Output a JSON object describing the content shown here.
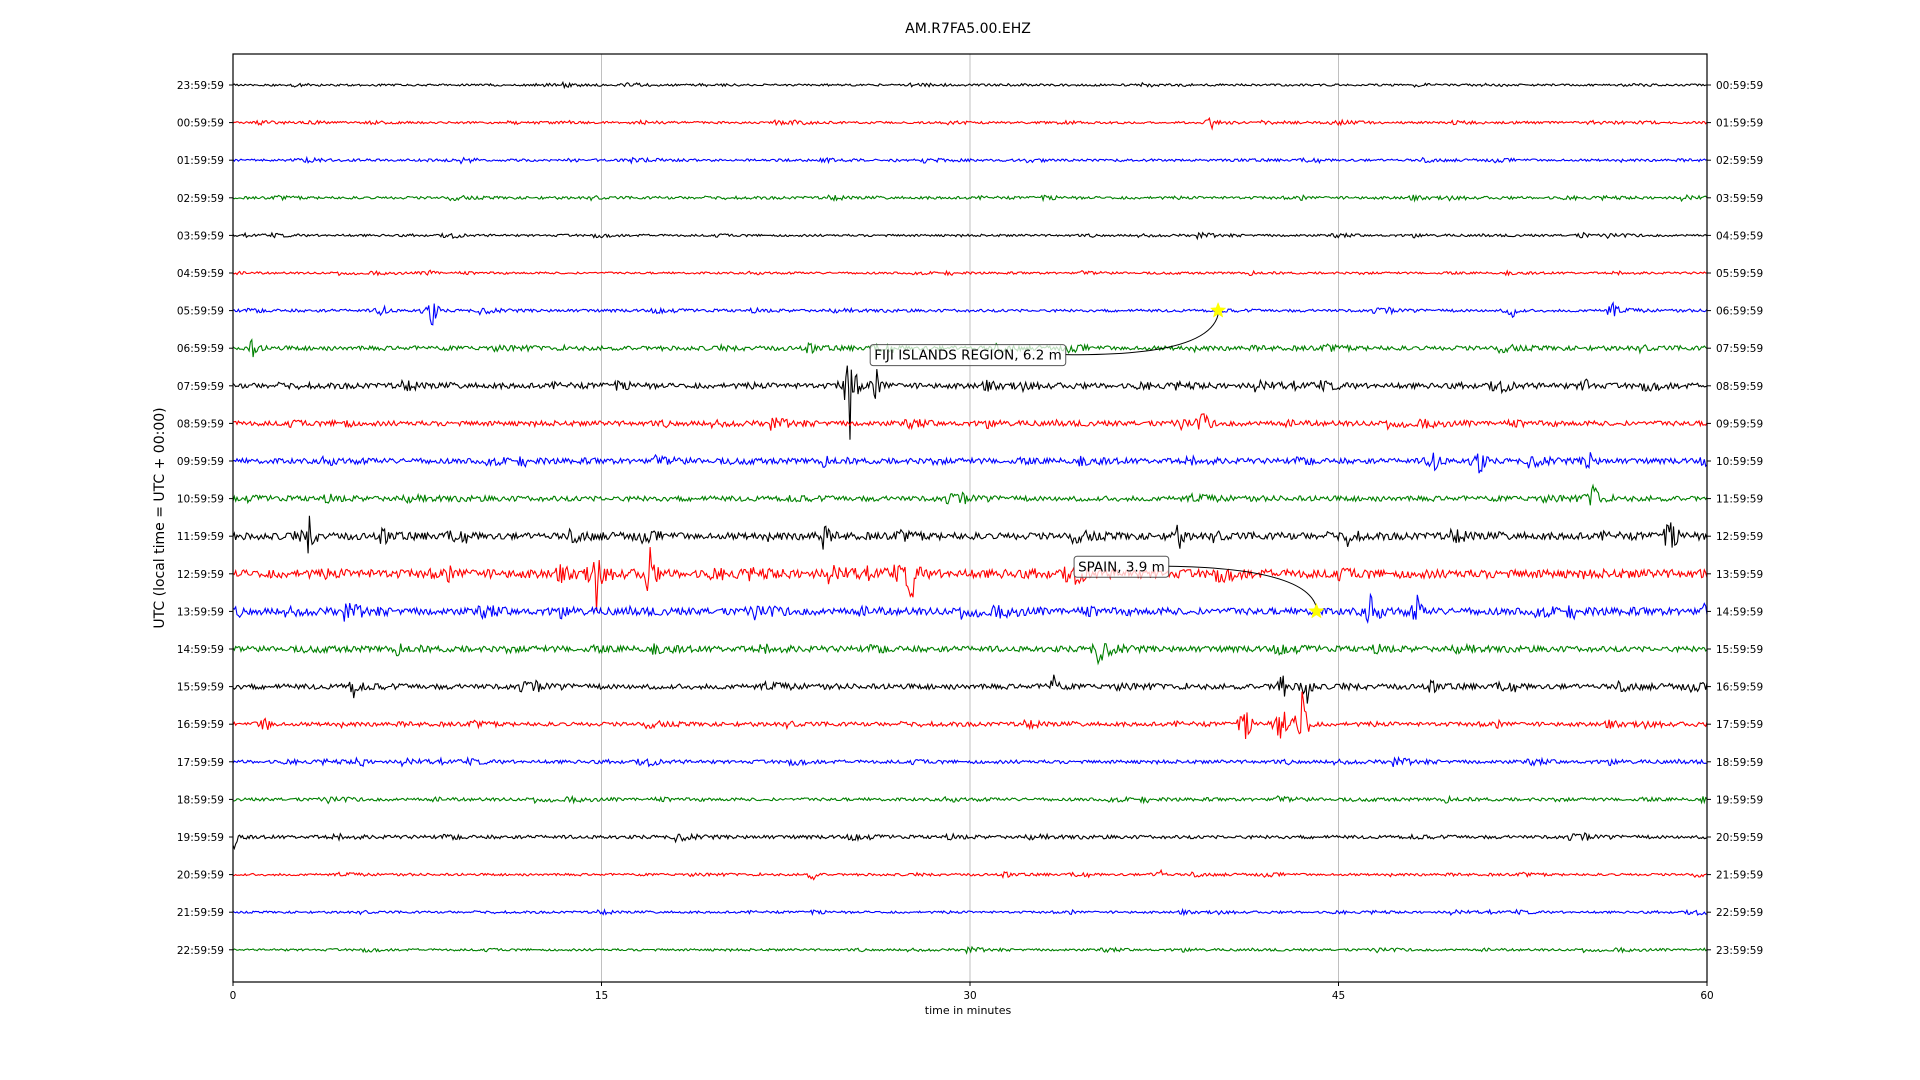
{
  "chart_data": {
    "type": "line",
    "title": "AM.R7FA5.00.EHZ",
    "xlabel": "time in minutes",
    "ylabel": "UTC (local time = UTC + 00:00)",
    "xlim": [
      0,
      60
    ],
    "xticks": [
      "0",
      "15",
      "30",
      "45",
      "60"
    ],
    "xtick_values": [
      0,
      15,
      30,
      45,
      60
    ],
    "grid": "vertical",
    "left_labels": [
      "23:59:59",
      "00:59:59",
      "01:59:59",
      "02:59:59",
      "03:59:59",
      "04:59:59",
      "05:59:59",
      "06:59:59",
      "07:59:59",
      "08:59:59",
      "09:59:59",
      "10:59:59",
      "11:59:59",
      "12:59:59",
      "13:59:59",
      "14:59:59",
      "15:59:59",
      "16:59:59",
      "17:59:59",
      "18:59:59",
      "19:59:59",
      "20:59:59",
      "21:59:59",
      "22:59:59"
    ],
    "right_labels": [
      "00:59:59",
      "01:59:59",
      "02:59:59",
      "03:59:59",
      "04:59:59",
      "05:59:59",
      "06:59:59",
      "07:59:59",
      "08:59:59",
      "09:59:59",
      "10:59:59",
      "11:59:59",
      "12:59:59",
      "13:59:59",
      "14:59:59",
      "15:59:59",
      "16:59:59",
      "17:59:59",
      "18:59:59",
      "19:59:59",
      "20:59:59",
      "21:59:59",
      "22:59:59",
      "23:59:59"
    ],
    "trace_colors": [
      "#000000",
      "#ff0000",
      "#0000ff",
      "#008000"
    ],
    "noise_levels": [
      1.0,
      1.1,
      1.2,
      1.3,
      1.1,
      1.0,
      1.4,
      2.2,
      2.6,
      2.4,
      2.6,
      2.6,
      3.4,
      4.2,
      3.4,
      2.8,
      2.6,
      2.0,
      1.7,
      1.5,
      1.7,
      1.2,
      1.1,
      1.1
    ],
    "spikes": [
      {
        "row": 1,
        "minute": 39.8,
        "amp": 7
      },
      {
        "row": 4,
        "minute": 55,
        "amp": 3
      },
      {
        "row": 5,
        "minute": 8,
        "amp": 5
      },
      {
        "row": 6,
        "minute": 8.1,
        "amp": 22
      },
      {
        "row": 6,
        "minute": 6.1,
        "amp": 9
      },
      {
        "row": 6,
        "minute": 52.1,
        "amp": 8
      },
      {
        "row": 6,
        "minute": 56.1,
        "amp": 10
      },
      {
        "row": 7,
        "minute": 0.8,
        "amp": 10
      },
      {
        "row": 8,
        "minute": 25.1,
        "amp": 60
      },
      {
        "row": 8,
        "minute": 26.2,
        "amp": 12
      },
      {
        "row": 8,
        "minute": 55.1,
        "amp": 9
      },
      {
        "row": 9,
        "minute": 4.5,
        "amp": 12
      },
      {
        "row": 9,
        "minute": 39.5,
        "amp": 12
      },
      {
        "row": 10,
        "minute": 48.9,
        "amp": 18
      },
      {
        "row": 10,
        "minute": 50.7,
        "amp": 20
      },
      {
        "row": 10,
        "minute": 55.2,
        "amp": 12
      },
      {
        "row": 11,
        "minute": 55.4,
        "amp": 22
      },
      {
        "row": 12,
        "minute": 3.1,
        "amp": 22
      },
      {
        "row": 12,
        "minute": 24,
        "amp": 14
      },
      {
        "row": 12,
        "minute": 38.5,
        "amp": 14
      },
      {
        "row": 12,
        "minute": 45.5,
        "amp": 14
      },
      {
        "row": 12,
        "minute": 58.5,
        "amp": 16
      },
      {
        "row": 13,
        "minute": 14.8,
        "amp": 30
      },
      {
        "row": 13,
        "minute": 17,
        "amp": 28
      },
      {
        "row": 13,
        "minute": 27.6,
        "amp": 28
      },
      {
        "row": 14,
        "minute": 46.3,
        "amp": 16
      },
      {
        "row": 14,
        "minute": 48.2,
        "amp": 14
      },
      {
        "row": 15,
        "minute": 35.2,
        "amp": 12
      },
      {
        "row": 16,
        "minute": 4.9,
        "amp": 10
      },
      {
        "row": 16,
        "minute": 33.4,
        "amp": 12
      },
      {
        "row": 16,
        "minute": 42.7,
        "amp": 22
      },
      {
        "row": 16,
        "minute": 43.7,
        "amp": 26
      },
      {
        "row": 17,
        "minute": 1.3,
        "amp": 14
      },
      {
        "row": 17,
        "minute": 41.2,
        "amp": 18
      },
      {
        "row": 17,
        "minute": 42.7,
        "amp": 34
      },
      {
        "row": 17,
        "minute": 43.5,
        "amp": 60
      },
      {
        "row": 18,
        "minute": 5.2,
        "amp": 6
      },
      {
        "row": 20,
        "minute": 0.05,
        "amp": 12
      },
      {
        "row": 21,
        "minute": 23.6,
        "amp": 6
      },
      {
        "row": 21,
        "minute": 37.7,
        "amp": 6
      }
    ],
    "annotations": [
      {
        "text": "FIJI ISLANDS REGION, 6.2 m",
        "star_row": 6,
        "star_minute": 40.1,
        "label_row": 7.17,
        "label_minute": 26.1
      },
      {
        "text": "SPAIN, 3.9 m",
        "star_row": 14,
        "star_minute": 44.1,
        "label_row": 12.8,
        "label_minute": 34.4
      }
    ],
    "star_color": "#ffff00"
  }
}
